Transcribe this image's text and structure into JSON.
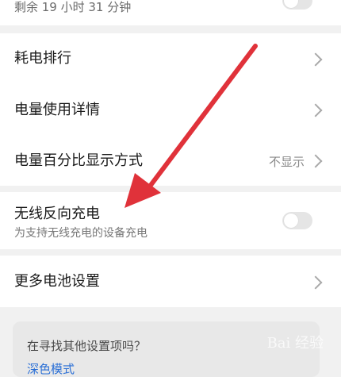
{
  "top_item": {
    "sub": "剩余 19 小时 31 分钟",
    "toggle_on": false
  },
  "items": [
    {
      "label": "耗电排行"
    },
    {
      "label": "电量使用详情"
    },
    {
      "label": "电量百分比显示方式",
      "value": "不显示"
    }
  ],
  "wireless": {
    "label": "无线反向充电",
    "sub": "为支持无线充电的设备充电",
    "toggle_on": false
  },
  "more": {
    "label": "更多电池设置"
  },
  "suggest": {
    "title": "在寻找其他设置项吗？",
    "link": "深色模式"
  },
  "watermark": {
    "text": "Bai 经验"
  },
  "colors": {
    "arrow": "#e0323a",
    "link": "#2a6fd6"
  }
}
